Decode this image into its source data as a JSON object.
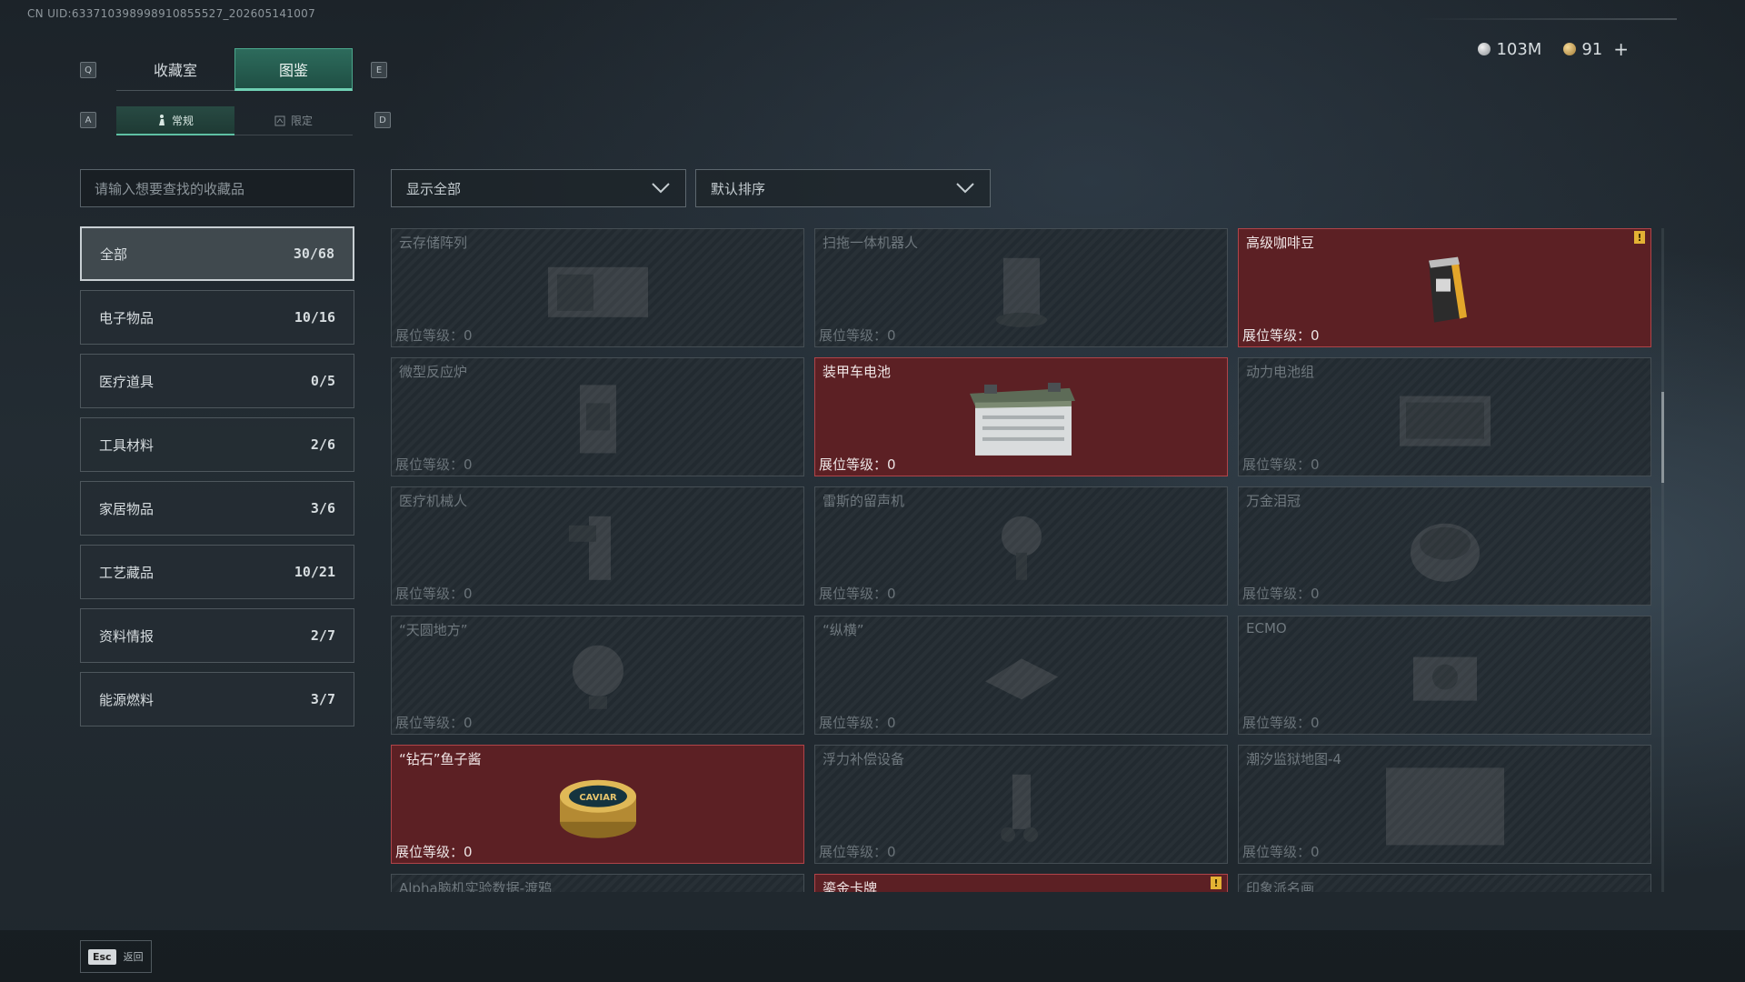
{
  "uid_text": "CN UID:633710398998910855527_202605141007",
  "currency": {
    "silver": "103M",
    "gold": "91",
    "add": "+"
  },
  "keys": {
    "q": "Q",
    "e": "E",
    "a": "A",
    "d": "D"
  },
  "tabs": [
    {
      "label": "收藏室"
    },
    {
      "label": "图鉴",
      "active": true
    }
  ],
  "subtabs": [
    {
      "label": "常规",
      "active": true
    },
    {
      "label": "限定"
    }
  ],
  "search": {
    "placeholder": "请输入想要查找的收藏品"
  },
  "filter": {
    "value": "显示全部"
  },
  "sort": {
    "value": "默认排序"
  },
  "categories": [
    {
      "label": "全部",
      "count": "30/68",
      "active": true
    },
    {
      "label": "电子物品",
      "count": "10/16"
    },
    {
      "label": "医疗道具",
      "count": "0/5"
    },
    {
      "label": "工具材料",
      "count": "2/6"
    },
    {
      "label": "家居物品",
      "count": "3/6"
    },
    {
      "label": "工艺藏品",
      "count": "10/21"
    },
    {
      "label": "资料情报",
      "count": "2/7"
    },
    {
      "label": "能源燃料",
      "count": "3/7"
    }
  ],
  "items": [
    {
      "name": "云存储阵列",
      "level": "展位等级：0",
      "owned": false,
      "icon": "server-rack-icon"
    },
    {
      "name": "扫拖一体机器人",
      "level": "展位等级：0",
      "owned": false,
      "icon": "robot-vacuum-icon"
    },
    {
      "name": "高级咖啡豆",
      "level": "展位等级：0",
      "owned": true,
      "icon": "coffee-bag-icon",
      "alert": "!"
    },
    {
      "name": "微型反应炉",
      "level": "展位等级：0",
      "owned": false,
      "icon": "reactor-icon"
    },
    {
      "name": "装甲车电池",
      "level": "展位等级：0",
      "owned": true,
      "icon": "battery-icon"
    },
    {
      "name": "动力电池组",
      "level": "展位等级：0",
      "owned": false,
      "icon": "battery-pack-icon"
    },
    {
      "name": "医疗机械人",
      "level": "展位等级：0",
      "owned": false,
      "icon": "medical-robot-icon"
    },
    {
      "name": "雷斯的留声机",
      "level": "展位等级：0",
      "owned": false,
      "icon": "gramophone-icon"
    },
    {
      "name": "万金泪冠",
      "level": "展位等级：0",
      "owned": false,
      "icon": "crown-icon"
    },
    {
      "name": "“天圆地方”",
      "level": "展位等级：0",
      "owned": false,
      "icon": "globe-icon"
    },
    {
      "name": "“纵横”",
      "level": "展位等级：0",
      "owned": false,
      "icon": "chessboard-icon"
    },
    {
      "name": "ECMO",
      "level": "展位等级：0",
      "owned": false,
      "icon": "ecmo-icon"
    },
    {
      "name": "“钻石”鱼子酱",
      "level": "展位等级：0",
      "owned": true,
      "icon": "caviar-tin-icon",
      "label": "CAVIAR"
    },
    {
      "name": "浮力补偿设备",
      "level": "展位等级：0",
      "owned": false,
      "icon": "bcd-icon"
    },
    {
      "name": "潮汐监狱地图-4",
      "level": "展位等级：0",
      "owned": false,
      "icon": "map-icon"
    },
    {
      "name": "Alpha脑机实验数据-渡鸦",
      "level": "",
      "owned": false,
      "icon": "data-chip-icon"
    },
    {
      "name": "鎏金卡牌",
      "level": "",
      "owned": true,
      "icon": "card-icon",
      "alert": "!"
    },
    {
      "name": "印象派名画",
      "level": "",
      "owned": false,
      "icon": "painting-icon"
    }
  ],
  "footer": {
    "esc_key": "Esc",
    "esc_label": "返回"
  }
}
